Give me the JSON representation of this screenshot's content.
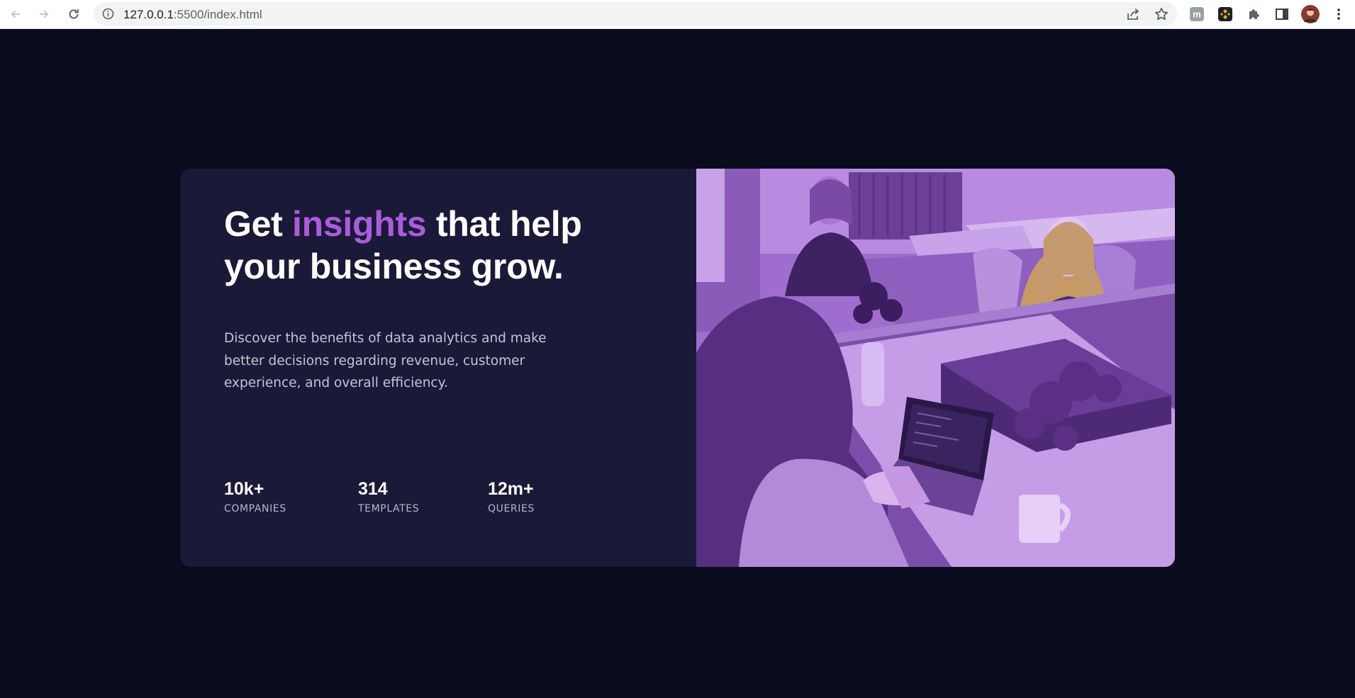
{
  "browser": {
    "url_host": "127.0.0.1",
    "url_rest": ":5500/index.html",
    "icons": [
      "back-arrow-icon",
      "forward-arrow-icon",
      "reload-icon",
      "site-info-icon",
      "share-icon",
      "bookmark-star-icon",
      "mendeley-extension-icon",
      "binance-extension-icon",
      "extensions-puzzle-icon",
      "side-panel-icon",
      "profile-avatar",
      "more-menu-icon"
    ]
  },
  "hero": {
    "headline_part1": "Get ",
    "headline_accent": "insights",
    "headline_part2": " that help your business grow.",
    "description": "Discover the benefits of data analytics and make better decisions regarding revenue, customer experience, and overall efficiency.",
    "accent_color": "#aa5cdb",
    "card_color": "#1b1938",
    "page_background": "#090c1c"
  },
  "stats": [
    {
      "value": "10k+",
      "label": "COMPANIES"
    },
    {
      "value": "314",
      "label": "TEMPLATES"
    },
    {
      "value": "12m+",
      "label": "QUERIES"
    }
  ],
  "image": {
    "description_icon": "office-team-photo",
    "tint": "#aa5cdb"
  }
}
